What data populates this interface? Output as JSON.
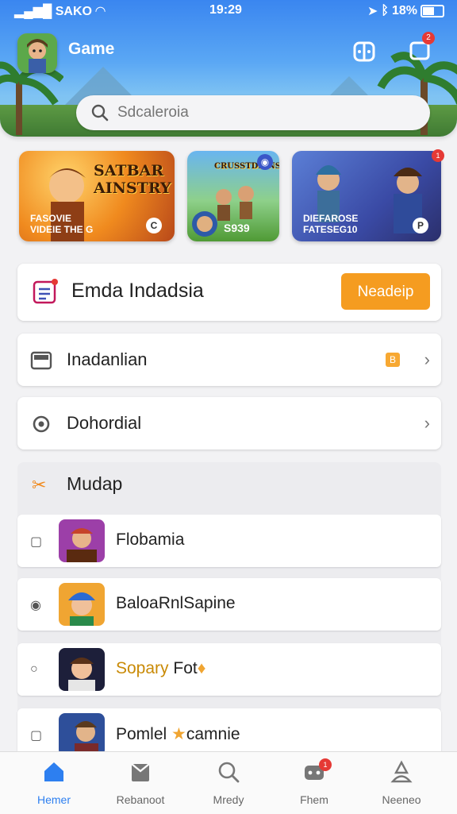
{
  "status_bar": {
    "carrier": "SAKO",
    "time": "19:29",
    "battery": "18%"
  },
  "header": {
    "title": "Game",
    "notification_count": "2"
  },
  "search": {
    "placeholder": "Sdcaleroia"
  },
  "banners": [
    {
      "title": "SATBAR AINSTRY",
      "sub1": "FASOVIE",
      "sub2": "VIDEIE THE G",
      "badge": "C"
    },
    {
      "title": "CRUSSTDEINS",
      "sub": "S939",
      "badge": "◉"
    },
    {
      "sub1": "DIEFAROSE",
      "sub2": "FATESEG10",
      "badge": "P",
      "red_badge": "1"
    }
  ],
  "feature_card": {
    "label": "Emda Indadsia",
    "button": "Neadeip"
  },
  "rows": [
    {
      "label": "Inadanlian",
      "badge": "B"
    },
    {
      "label": "Dohordial"
    }
  ],
  "section": {
    "title": "Mudap",
    "games": [
      {
        "name": "Flobamia"
      },
      {
        "name": "BaloaRnlSapine"
      },
      {
        "name": "Sopary",
        "name2": "Fot"
      },
      {
        "name": "Pomlel",
        "name2": "camnie"
      }
    ]
  },
  "tabs": [
    {
      "label": "Hemer",
      "icon": "home-icon",
      "active": true
    },
    {
      "label": "Rebanoot",
      "icon": "store-icon"
    },
    {
      "label": "Mredy",
      "icon": "search-icon"
    },
    {
      "label": "Fhem",
      "icon": "gamepad-icon",
      "badge": "1"
    },
    {
      "label": "Neeneo",
      "icon": "profile-icon"
    }
  ],
  "colors": {
    "accent": "#2d7ff0",
    "cta": "#f59c20",
    "badge": "#e53935"
  }
}
